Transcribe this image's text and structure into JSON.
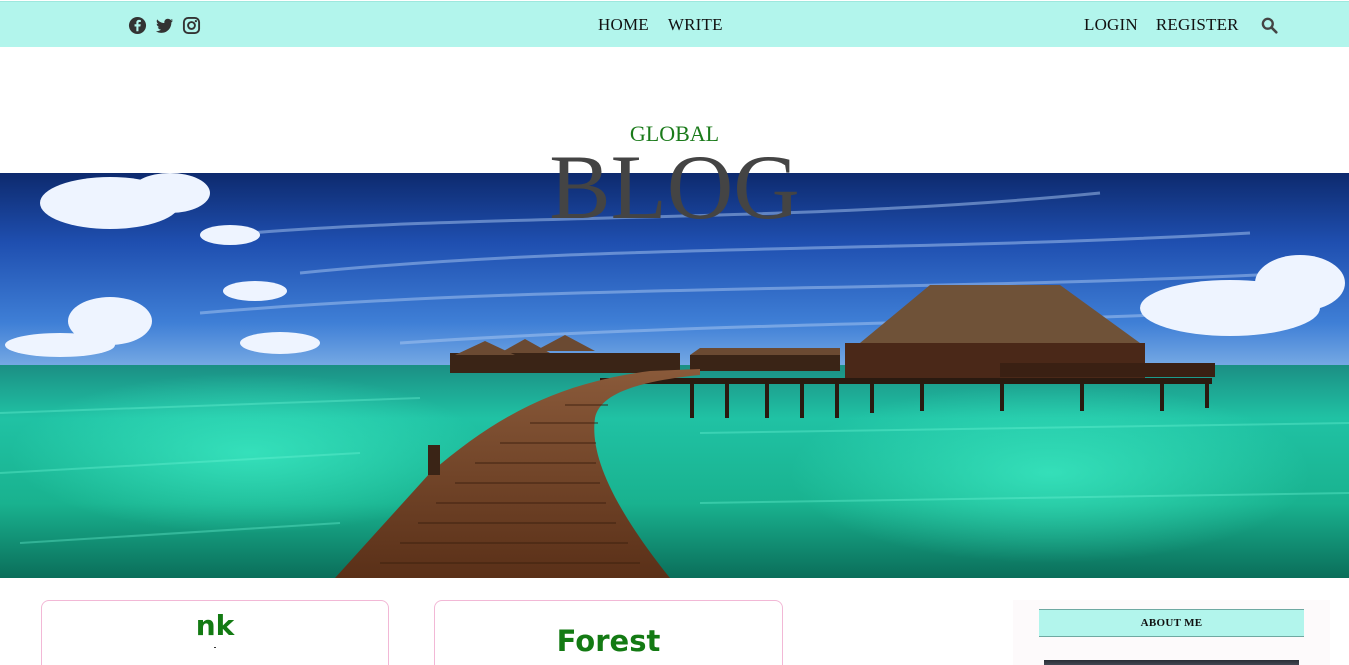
{
  "topbar": {
    "social": [
      "facebook-icon",
      "twitter-icon",
      "instagram-icon"
    ],
    "nav_center": [
      {
        "label": "HOME"
      },
      {
        "label": "WRITE"
      }
    ],
    "nav_right": [
      {
        "label": "LOGIN"
      },
      {
        "label": "REGISTER"
      }
    ],
    "search_icon": "search-icon",
    "background": "#b2f5ec"
  },
  "header": {
    "title_small": "GLOBAL",
    "title_large": "BLOG",
    "title_small_color": "#1a7a1a",
    "title_large_color": "#444444"
  },
  "posts": [
    {
      "title": "nk"
    },
    {
      "title": "Forest"
    }
  ],
  "sidebar": {
    "about_title": "ABOUT ME"
  },
  "colors": {
    "accent": "#b2f5ec",
    "post_title": "#137a13",
    "card_border": "#f2b8d6"
  }
}
